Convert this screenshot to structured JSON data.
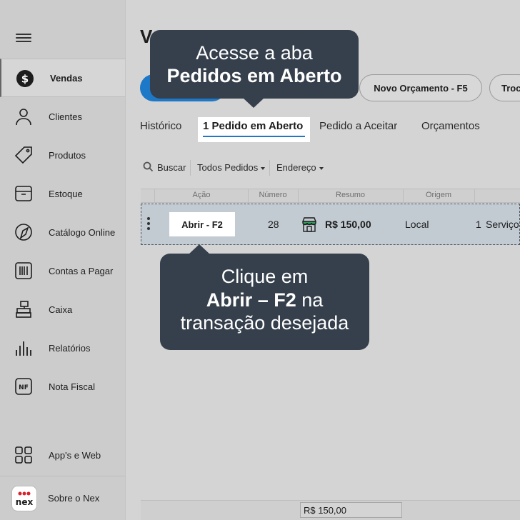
{
  "sidebar": {
    "items": [
      {
        "label": "Vendas",
        "icon": "dollar-circle-icon",
        "active": true
      },
      {
        "label": "Clientes",
        "icon": "person-icon"
      },
      {
        "label": "Produtos",
        "icon": "tag-icon"
      },
      {
        "label": "Estoque",
        "icon": "box-icon"
      },
      {
        "label": "Catálogo Online",
        "icon": "catalog-icon"
      },
      {
        "label": "Contas a Pagar",
        "icon": "barcode-icon"
      },
      {
        "label": "Caixa",
        "icon": "cash-register-icon"
      },
      {
        "label": "Relatórios",
        "icon": "bar-chart-icon"
      },
      {
        "label": "Nota Fiscal",
        "icon": "nf-icon"
      }
    ],
    "apps_label": "App's e Web",
    "about_label": "Sobre o Nex",
    "logo_text": "nex"
  },
  "main": {
    "title": "V",
    "buttons": {
      "novo_orcamento": "Novo Orçamento - F5",
      "troca": "Troc"
    },
    "tabs": [
      "Histórico",
      "1 Pedido em Aberto",
      "Pedido a Aceitar",
      "Orçamentos"
    ],
    "filters": {
      "search": "Buscar",
      "todos_pedidos": "Todos Pedidos",
      "endereco": "Endereço"
    },
    "table": {
      "headers": [
        "Ação",
        "Número",
        "Resumo",
        "Origem"
      ],
      "row": {
        "action": "Abrir - F2",
        "numero": "28",
        "valor": "R$ 150,00",
        "origem": "Local",
        "qtd": "1",
        "item": "Serviço"
      }
    },
    "footer_total": "R$ 150,00"
  },
  "tooltips": {
    "tip1_line1": "Acesse a aba",
    "tip1_line2": "Pedidos em Aberto",
    "tip2_line1": "Clique em",
    "tip2_bold": "Abrir – F2",
    "tip2_after": " na",
    "tip2_line3": "transação desejada"
  },
  "colors": {
    "primary": "#1d78c8",
    "tooltip_bg": "#36404d",
    "sidebar_bg": "#cccccc",
    "logo_red": "#d6232e"
  }
}
